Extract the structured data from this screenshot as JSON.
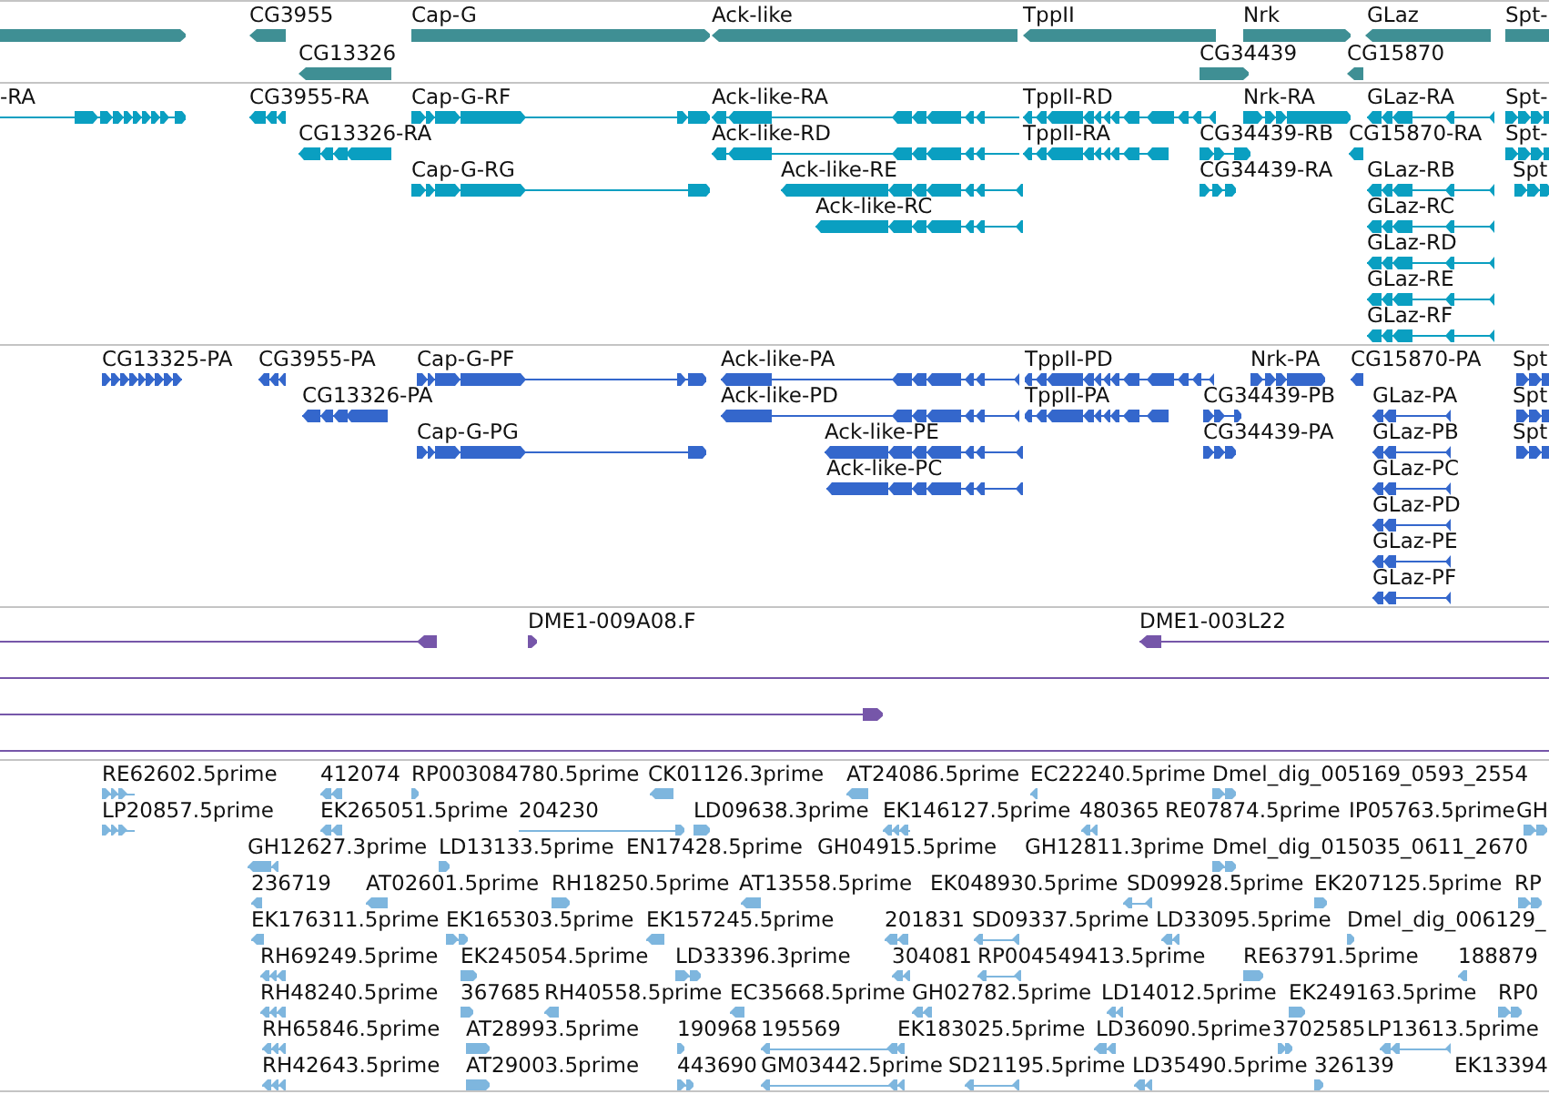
{
  "tracks": [
    {
      "kind": "gene",
      "rows": [
        {
          "features": [
            {
              "reverse": false
            },
            {
              "label": "CG3955",
              "reverse": true
            },
            {
              "label": "Cap-G",
              "reverse": false
            },
            {
              "label": "Ack-like",
              "reverse": true
            },
            {
              "label": "TppII",
              "reverse": true
            },
            {
              "label": "Nrk",
              "reverse": false
            },
            {
              "label": "GLaz",
              "reverse": true
            },
            {
              "label": "Spt-",
              "reverse": false
            }
          ]
        },
        {
          "features": [
            {
              "label": "CG13326",
              "reverse": true
            },
            {
              "label": "CG34439",
              "reverse": false
            },
            {
              "label": "CG15870",
              "reverse": true
            }
          ]
        }
      ]
    },
    {
      "kind": "transcript",
      "rows": [
        {
          "features": [
            {
              "label": "-RA",
              "reverse": false
            },
            {
              "label": "CG3955-RA",
              "reverse": true
            },
            {
              "label": "Cap-G-RF",
              "reverse": false
            },
            {
              "label": "Ack-like-RA",
              "reverse": true
            },
            {
              "label": "TppII-RD",
              "reverse": true
            },
            {
              "label": "Nrk-RA",
              "reverse": false
            },
            {
              "label": "GLaz-RA",
              "reverse": true
            },
            {
              "label": "Spt-",
              "reverse": false
            }
          ]
        },
        {
          "features": [
            {
              "label": "CG13326-RA",
              "reverse": true
            },
            {
              "label": "Ack-like-RD",
              "reverse": true
            },
            {
              "label": "TppII-RA",
              "reverse": true
            },
            {
              "label": "CG34439-RB",
              "reverse": false
            },
            {
              "label": "CG15870-RA",
              "reverse": true
            },
            {
              "label": "Spt-",
              "reverse": false
            }
          ]
        },
        {
          "features": [
            {
              "label": "Cap-G-RG",
              "reverse": false
            },
            {
              "label": "Ack-like-RE",
              "reverse": true
            },
            {
              "label": "CG34439-RA",
              "reverse": false
            },
            {
              "label": "GLaz-RB",
              "reverse": true
            },
            {
              "label": "Spt",
              "reverse": false
            }
          ]
        },
        {
          "features": [
            {
              "label": "Ack-like-RC",
              "reverse": true
            },
            {
              "label": "GLaz-RC",
              "reverse": true
            }
          ]
        },
        {
          "features": [
            {
              "label": "GLaz-RD",
              "reverse": true
            }
          ]
        },
        {
          "features": [
            {
              "label": "GLaz-RE",
              "reverse": true
            }
          ]
        },
        {
          "features": [
            {
              "label": "GLaz-RF",
              "reverse": true
            }
          ]
        }
      ]
    },
    {
      "kind": "protein",
      "rows": [
        {
          "features": [
            {
              "label": "CG13325-PA",
              "reverse": false
            },
            {
              "label": "CG3955-PA",
              "reverse": true
            },
            {
              "label": "Cap-G-PF",
              "reverse": false
            },
            {
              "label": "Ack-like-PA",
              "reverse": true
            },
            {
              "label": "TppII-PD",
              "reverse": true
            },
            {
              "label": "Nrk-PA",
              "reverse": false
            },
            {
              "label": "CG15870-PA",
              "reverse": true
            },
            {
              "label": "Spt",
              "reverse": false
            }
          ]
        },
        {
          "features": [
            {
              "label": "CG13326-PA",
              "reverse": true
            },
            {
              "label": "Ack-like-PD",
              "reverse": true
            },
            {
              "label": "TppII-PA",
              "reverse": true
            },
            {
              "label": "CG34439-PB",
              "reverse": false
            },
            {
              "label": "GLaz-PA",
              "reverse": true
            },
            {
              "label": "Spt",
              "reverse": false
            }
          ]
        },
        {
          "features": [
            {
              "label": "Cap-G-PG",
              "reverse": false
            },
            {
              "label": "Ack-like-PE",
              "reverse": true
            },
            {
              "label": "CG34439-PA",
              "reverse": false
            },
            {
              "label": "GLaz-PB",
              "reverse": true
            },
            {
              "label": "Spt",
              "reverse": false
            }
          ]
        },
        {
          "features": [
            {
              "label": "Ack-like-PC",
              "reverse": true
            },
            {
              "label": "GLaz-PC",
              "reverse": true
            }
          ]
        },
        {
          "features": [
            {
              "label": "GLaz-PD",
              "reverse": true
            }
          ]
        },
        {
          "features": [
            {
              "label": "GLaz-PE",
              "reverse": true
            }
          ]
        },
        {
          "features": [
            {
              "label": "GLaz-PF",
              "reverse": true
            }
          ]
        }
      ]
    },
    {
      "kind": "clone",
      "rows": [
        {
          "features": [
            {
              "kind": "read",
              "reverse": true
            },
            {
              "kind": "read",
              "label": "DME1-009A08.F",
              "reverse": false
            },
            {
              "kind": "read",
              "label": "DME1-003L22",
              "reverse": true
            }
          ]
        },
        {
          "features": [
            {
              "kind": "span"
            }
          ]
        },
        {
          "features": [
            {
              "kind": "read",
              "reverse": false
            }
          ]
        },
        {
          "features": [
            {
              "kind": "span"
            }
          ]
        }
      ]
    },
    {
      "kind": "est",
      "rows": [
        {
          "features": [
            {
              "label": "RE62602.5prime",
              "reverse": false
            },
            {
              "label": "412074",
              "reverse": true
            },
            {
              "label": "RP003084780.5prime",
              "reverse": false
            },
            {
              "label": "CK01126.3prime",
              "reverse": true
            },
            {
              "label": "AT24086.5prime",
              "reverse": true
            },
            {
              "label": "EC22240.5prime",
              "reverse": true
            },
            {
              "label": "Dmel_dig_005169_0593_2554",
              "reverse": false
            }
          ]
        },
        {
          "features": [
            {
              "label": "LP20857.5prime",
              "reverse": false
            },
            {
              "label": "EK265051.5prime",
              "reverse": true
            },
            {
              "label": "204230",
              "reverse": false
            },
            {
              "label": "LD09638.3prime",
              "reverse": false
            },
            {
              "label": "EK146127.5prime",
              "reverse": true
            },
            {
              "label": "480365",
              "reverse": true
            },
            {
              "label": "RE07874.5prime"
            },
            {
              "label": "IP05763.5prime"
            },
            {
              "label": "GH",
              "reverse": false
            }
          ]
        },
        {
          "features": [
            {
              "label": "GH12627.3prime",
              "reverse": true
            },
            {
              "label": "LD13133.5prime",
              "reverse": false
            },
            {
              "label": "EN17428.5prime"
            },
            {
              "label": "GH04915.5prime"
            },
            {
              "label": "GH12811.3prime"
            },
            {
              "label": "Dmel_dig_015035_0611_2670",
              "reverse": false
            }
          ]
        },
        {
          "features": [
            {
              "label": "236719",
              "reverse": true
            },
            {
              "label": "AT02601.5prime",
              "reverse": true
            },
            {
              "label": "RH18250.5prime",
              "reverse": false
            },
            {
              "label": "AT13558.5prime",
              "reverse": true
            },
            {
              "label": "EK048930.5prime"
            },
            {
              "label": "SD09928.5prime",
              "reverse": true
            },
            {
              "label": "EK207125.5prime",
              "reverse": false
            },
            {
              "label": "RP",
              "reverse": false
            }
          ]
        },
        {
          "features": [
            {
              "label": "EK176311.5prime",
              "reverse": true
            },
            {
              "label": "EK165303.5prime",
              "reverse": false
            },
            {
              "label": "EK157245.5prime",
              "reverse": true
            },
            {
              "label": "201831",
              "reverse": true
            },
            {
              "label": "SD09337.5prime",
              "reverse": true
            },
            {
              "label": "LD33095.5prime",
              "reverse": true
            },
            {
              "label": "Dmel_dig_006129_",
              "reverse": false
            }
          ]
        },
        {
          "features": [
            {
              "label": "RH69249.5prime",
              "reverse": true
            },
            {
              "label": "EK245054.5prime",
              "reverse": false
            },
            {
              "label": "LD33396.3prime",
              "reverse": false
            },
            {
              "label": "304081",
              "reverse": true
            },
            {
              "label": "RP004549413.5prime",
              "reverse": true
            },
            {
              "label": "RE63791.5prime",
              "reverse": false
            },
            {
              "label": "188879",
              "reverse": true
            }
          ]
        },
        {
          "features": [
            {
              "label": "RH48240.5prime",
              "reverse": true
            },
            {
              "label": "367685",
              "reverse": false
            },
            {
              "label": "RH40558.5prime",
              "reverse": true
            },
            {
              "label": "EC35668.5prime",
              "reverse": true
            },
            {
              "label": "GH02782.5prime",
              "reverse": true
            },
            {
              "label": "LD14012.5prime",
              "reverse": true
            },
            {
              "label": "EK249163.5prime",
              "reverse": false
            },
            {
              "label": "RP0",
              "reverse": false
            }
          ]
        },
        {
          "features": [
            {
              "label": "RH65846.5prime",
              "reverse": true
            },
            {
              "label": "AT28993.5prime",
              "reverse": false
            },
            {
              "label": "190968",
              "reverse": false
            },
            {
              "label": "195569",
              "reverse": true
            },
            {
              "label": "EK183025.5prime"
            },
            {
              "label": "LD36090.5prime",
              "reverse": true
            },
            {
              "label": "3702585",
              "reverse": false
            },
            {
              "label": "LP13613.5prime",
              "reverse": true
            }
          ]
        },
        {
          "features": [
            {
              "label": "RH42643.5prime",
              "reverse": true
            },
            {
              "label": "AT29003.5prime",
              "reverse": false
            },
            {
              "label": "443690",
              "reverse": false
            },
            {
              "label": "GM03442.5prime",
              "reverse": true
            },
            {
              "label": "SD21195.5prime",
              "reverse": true
            },
            {
              "label": "LD35490.5prime",
              "reverse": true
            },
            {
              "label": "326139",
              "reverse": false
            },
            {
              "label": "EK13394"
            }
          ]
        }
      ]
    }
  ]
}
